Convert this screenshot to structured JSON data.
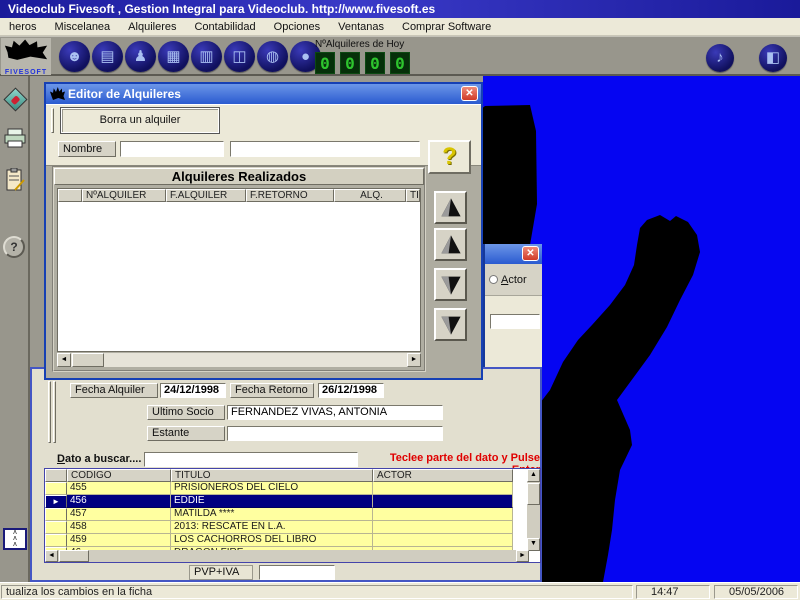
{
  "window": {
    "title": "Videoclub Fivesoft , Gestion Integral para Videoclub. http://www.fivesoft.es"
  },
  "menu": {
    "items": [
      "heros",
      "Miscelanea",
      "Alquileres",
      "Contabilidad",
      "Opciones",
      "Ventanas",
      "Comprar Software"
    ]
  },
  "toolbar": {
    "logo_text": "FIVESOFT",
    "icons": [
      {
        "name": "members-icon",
        "glyph": "☻"
      },
      {
        "name": "tape-icon",
        "glyph": "▤"
      },
      {
        "name": "person-icon",
        "glyph": "♟"
      },
      {
        "name": "printer-icon",
        "glyph": "▦"
      },
      {
        "name": "register-icon",
        "glyph": "▥"
      },
      {
        "name": "camera-icon",
        "glyph": "◫"
      },
      {
        "name": "money-icon",
        "glyph": "◍"
      },
      {
        "name": "extra-icon",
        "glyph": "●"
      }
    ],
    "right_icons": [
      {
        "name": "music-icon",
        "glyph": "♪"
      },
      {
        "name": "exit-icon",
        "glyph": "◧"
      }
    ],
    "counter_label": "NºAlquileres de Hoy",
    "counter_digits": [
      "0",
      "0",
      "0",
      "0"
    ]
  },
  "dialog": {
    "title": "Editor de Alquileres",
    "delete_button": "Borra un alquiler",
    "nombre_label": "Nombre",
    "help_glyph": "?",
    "table": {
      "title": "Alquileres Realizados",
      "columns": [
        "NºALQUILER",
        "F.ALQUILER",
        "F.RETORNO",
        "ALQ.",
        "TITULO"
      ]
    }
  },
  "actor_window": {
    "radio_label": "Actor"
  },
  "ficha": {
    "fecha_alquiler_label": "Fecha Alquiler",
    "fecha_alquiler_value": "24/12/1998",
    "fecha_retorno_label": "Fecha Retorno",
    "fecha_retorno_value": "26/12/1998",
    "ultimo_socio_label": "Ultimo Socio",
    "ultimo_socio_value": "FERNANDEZ VIVAS, ANTONIA",
    "estante_label": "Estante",
    "estante_value": "",
    "search_label": "Dato a buscar....",
    "search_value": "",
    "search_hint": "Teclee parte del dato y Pulse Enter",
    "grid": {
      "columns": [
        "CODIGO",
        "TITULO",
        "ACTOR"
      ],
      "rows": [
        {
          "codigo": "455",
          "titulo": "PRISIONEROS DEL CIELO",
          "actor": ""
        },
        {
          "codigo": "456",
          "titulo": "EDDIE",
          "actor": "",
          "selected": true
        },
        {
          "codigo": "457",
          "titulo": "MATILDA ****",
          "actor": ""
        },
        {
          "codigo": "458",
          "titulo": "2013: RESCATE EN L.A.",
          "actor": ""
        },
        {
          "codigo": "459",
          "titulo": "LOS CACHORROS DEL LIBRO",
          "actor": ""
        },
        {
          "codigo": "46",
          "titulo": "DRAGON FIRE",
          "actor": ""
        }
      ]
    },
    "pvp_label": "PVP+IVA",
    "pvp_value": ""
  },
  "statusbar": {
    "message": "tualiza los cambios en la ficha",
    "time": "14:47",
    "date": "05/05/2006"
  },
  "colors": {
    "mdi_blue": "#0505f2",
    "selection_blue": "#000080",
    "row_yellow": "#ffffa0",
    "hint_red": "#e00000",
    "led_green": "#2ec52e",
    "title_blue": "#2a5ad0"
  }
}
